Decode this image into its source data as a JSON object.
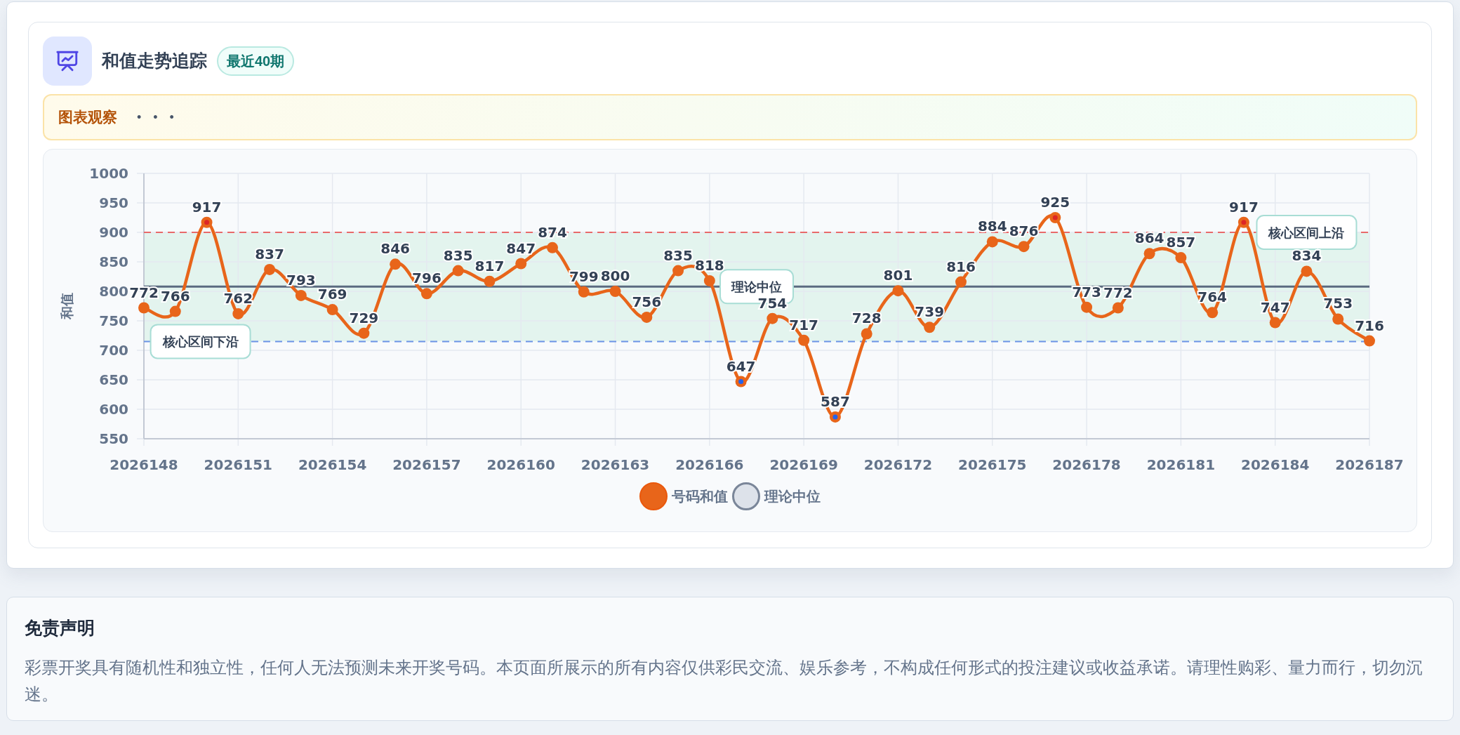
{
  "chart_card": {
    "title": "和值走势追踪",
    "badge": "最近40期",
    "insight": {
      "label": "图表观察",
      "dots": "• • •"
    },
    "chart_data": {
      "type": "line",
      "ylabel": "和值",
      "ylim": [
        550,
        1000
      ],
      "yticks": [
        550,
        600,
        650,
        700,
        750,
        800,
        850,
        900,
        950,
        1000
      ],
      "x": [
        2026148,
        2026149,
        2026150,
        2026151,
        2026152,
        2026153,
        2026154,
        2026155,
        2026156,
        2026157,
        2026158,
        2026159,
        2026160,
        2026161,
        2026162,
        2026163,
        2026164,
        2026165,
        2026166,
        2026167,
        2026168,
        2026169,
        2026170,
        2026171,
        2026172,
        2026173,
        2026174,
        2026175,
        2026176,
        2026177,
        2026178,
        2026179,
        2026180,
        2026181,
        2026182,
        2026183,
        2026184,
        2026185,
        2026186,
        2026187
      ],
      "xlim": [
        2026148,
        2026187
      ],
      "xticks": [
        2026148,
        2026151,
        2026154,
        2026157,
        2026160,
        2026163,
        2026166,
        2026169,
        2026172,
        2026175,
        2026178,
        2026181,
        2026184,
        2026187
      ],
      "grid": true,
      "series": [
        {
          "name": "号码和值",
          "color": "#e8651a",
          "marker": "circle",
          "values": [
            772,
            766,
            917,
            762,
            837,
            793,
            769,
            729,
            846,
            796,
            835,
            817,
            847,
            874,
            799,
            800,
            756,
            835,
            818,
            647,
            754,
            717,
            587,
            728,
            801,
            739,
            816,
            884,
            876,
            925,
            773,
            772,
            864,
            857,
            764,
            917,
            747,
            834,
            753,
            716
          ]
        }
      ],
      "data_labels": true,
      "ref_lines": [
        {
          "axis": "y",
          "value": 900,
          "label": "核心区间上沿",
          "color": "#e86a6a"
        },
        {
          "axis": "y",
          "value": 808,
          "label": "理论中位",
          "color": "#5b6b80"
        },
        {
          "axis": "y",
          "value": 715,
          "label": "核心区间下沿",
          "color": "#6b93e6"
        }
      ]
    },
    "legend": [
      {
        "kind": "series"
      },
      {
        "label": "理论中位",
        "kind": "median"
      }
    ]
  },
  "disclaimer": {
    "title": "免责声明",
    "text": "彩票开奖具有随机性和独立性，任何人无法预测未来开奖号码。本页面所展示的所有内容仅供彩民交流、娱乐参考，不构成任何形式的投注建议或收益承诺。请理性购彩、量力而行，切勿沉迷。"
  }
}
